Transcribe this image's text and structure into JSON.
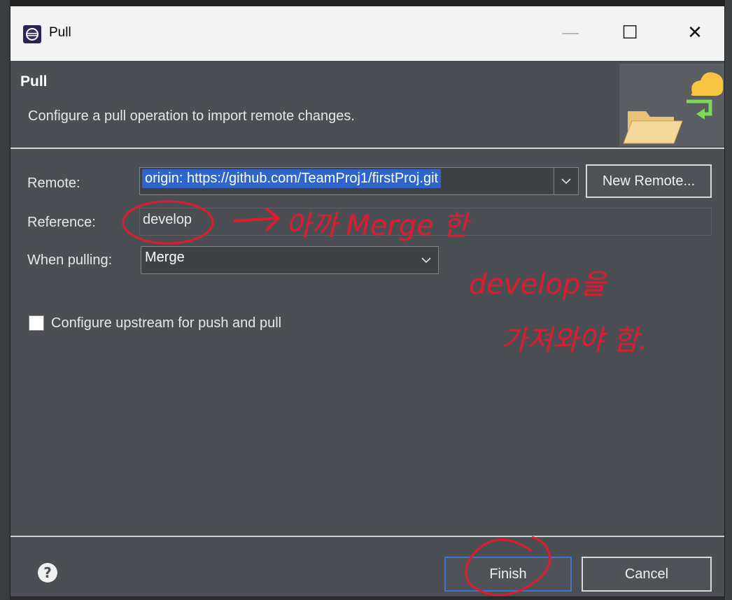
{
  "window": {
    "title": "Pull",
    "minimize_glyph": "—",
    "maximize_glyph": "☐",
    "close_glyph": "✕"
  },
  "banner": {
    "title": "Pull",
    "description": "Configure a pull operation to import remote changes."
  },
  "form": {
    "remote_label": "Remote:",
    "remote_value": "origin: https://github.com/TeamProj1/firstProj.git",
    "new_remote_label": "New Remote...",
    "reference_label": "Reference:",
    "reference_value": "develop",
    "when_pulling_label": "When pulling:",
    "when_pulling_value": "Merge",
    "configure_upstream_label": "Configure upstream for push and pull",
    "configure_upstream_checked": false
  },
  "footer": {
    "help_glyph": "?",
    "finish_label": "Finish",
    "cancel_label": "Cancel"
  },
  "annotation": {
    "line1": "아까 Merge 한",
    "line2": "develop을",
    "line3": "가져와야 함."
  },
  "colors": {
    "dialog_bg": "#4b4f53",
    "selection": "#2f65ca",
    "annotation_red": "#e11b2f",
    "focus_border": "#3b78c9"
  }
}
